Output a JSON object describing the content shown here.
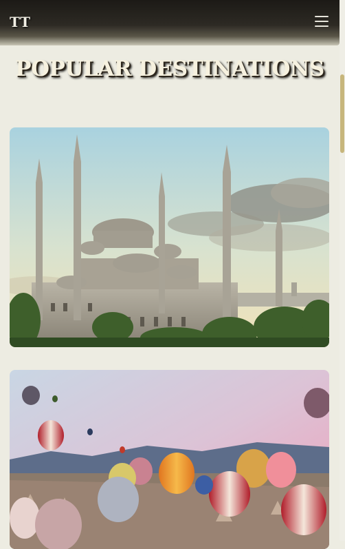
{
  "header": {
    "logo": "TT",
    "menu_icon": "hamburger-menu-icon"
  },
  "main": {
    "title": "POPULAR DESTINATIONS"
  },
  "destinations": [
    {
      "image": "blue-mosque-istanbul"
    },
    {
      "image": "cappadocia-hot-air-balloons"
    }
  ]
}
